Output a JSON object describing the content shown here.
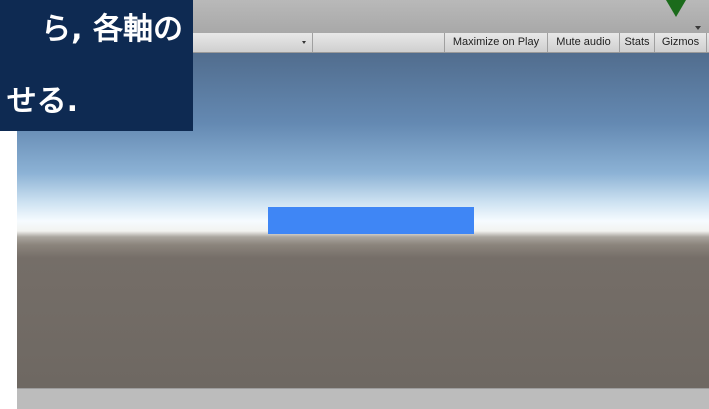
{
  "caption": {
    "line1": "ら, 各軸の",
    "line2": "せる."
  },
  "toolbar": {
    "aspect_value": "",
    "maximize_on_play_label": "Maximize on Play",
    "mute_audio_label": "Mute audio",
    "stats_label": "Stats",
    "gizmos_label": "Gizmos"
  },
  "icons": {
    "dropdown_arrow": "chevron-down-icon",
    "tab_menu": "chevron-down-icon",
    "pointer": "down-arrow-icon"
  },
  "colors": {
    "caption_background": "#0e2a52",
    "pointer_arrow": "#1b6b1b",
    "blue_box": "#3f86f5",
    "sky_top": "#516d8e",
    "horizon": "#f6fbff",
    "ground": "#6e6862"
  }
}
